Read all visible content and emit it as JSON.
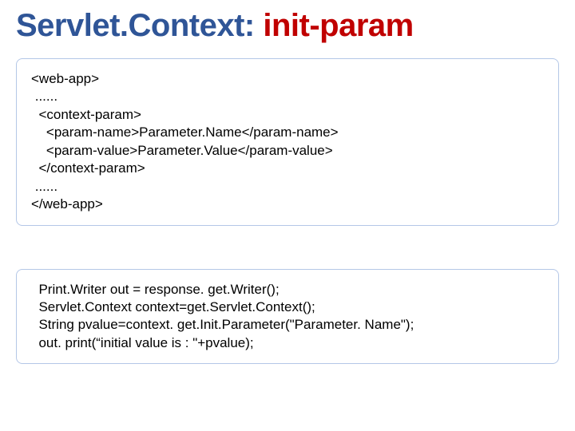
{
  "title": {
    "part1": "Servlet.Context: ",
    "part2": "init-param"
  },
  "codebox1": "<web-app>\n ......\n  <context-param>\n    <param-name>Parameter.Name</param-name>\n    <param-value>Parameter.Value</param-value>\n  </context-param>\n ......\n</web-app>",
  "codebox2": "  Print.Writer out = response. get.Writer();\n  Servlet.Context context=get.Servlet.Context();\n  String pvalue=context. get.Init.Parameter(\"Parameter. Name\");\n  out. print(“initial value is : \"+pvalue);"
}
